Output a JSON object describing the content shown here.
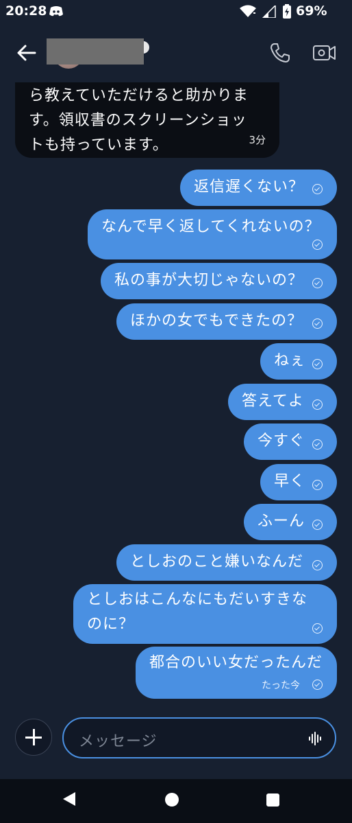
{
  "status_bar": {
    "time": "20:28",
    "battery_percent": "69%",
    "icons": [
      "discord-icon",
      "wifi-icon",
      "signal-icon",
      "battery-icon"
    ]
  },
  "header": {
    "icons": [
      "back-arrow-icon",
      "phone-icon",
      "video-camera-icon"
    ]
  },
  "messages": [
    {
      "direction": "incoming",
      "lines": [
        "ら教えていただけると助かりま",
        "す。領収書のスクリーンショッ",
        "トも持っています。"
      ],
      "time": "3分"
    },
    {
      "direction": "outgoing",
      "text": "返信遅くない？"
    },
    {
      "direction": "outgoing",
      "text": "なんで早く返してくれないの？"
    },
    {
      "direction": "outgoing",
      "text": "私の事が大切じゃないの？"
    },
    {
      "direction": "outgoing",
      "text": "ほかの女でもできたの？"
    },
    {
      "direction": "outgoing",
      "text": "ねぇ"
    },
    {
      "direction": "outgoing",
      "text": "答えてよ"
    },
    {
      "direction": "outgoing",
      "text": "今すぐ"
    },
    {
      "direction": "outgoing",
      "text": "早く"
    },
    {
      "direction": "outgoing",
      "text": "ふーん"
    },
    {
      "direction": "outgoing",
      "text": "としおのこと嫌いなんだ"
    },
    {
      "direction": "outgoing",
      "lines": [
        "としおはこんなにもだいすきな",
        "のに？"
      ]
    },
    {
      "direction": "outgoing",
      "text": "都合のいい女だったんだ",
      "time": "たった今"
    }
  ],
  "composer": {
    "placeholder": "メッセージ",
    "icons": [
      "plus-icon",
      "voice-wave-icon"
    ]
  },
  "colors": {
    "background": "#172030",
    "outgoing_bubble": "#4a90e2",
    "incoming_bubble": "#0b0e14",
    "input_border": "#4a90e2"
  }
}
